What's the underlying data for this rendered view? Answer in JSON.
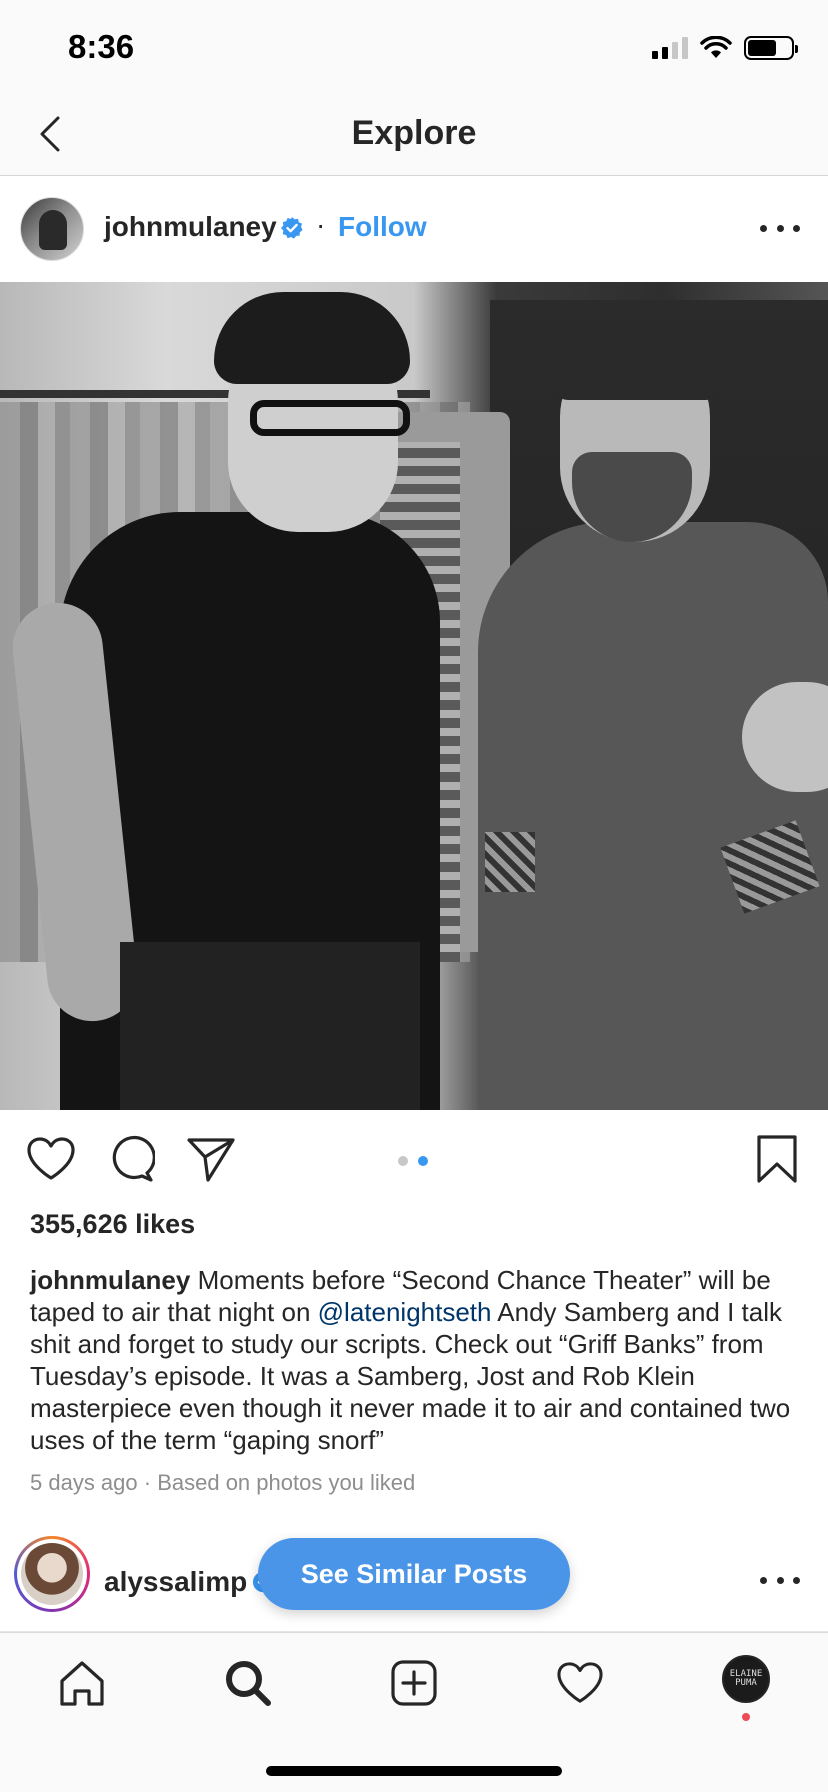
{
  "status_bar": {
    "time": "8:36"
  },
  "header": {
    "title": "Explore"
  },
  "post": {
    "username": "johnmulaney",
    "separator": "·",
    "follow_label": "Follow",
    "likes": "355,626 likes",
    "caption_user": "johnmulaney",
    "caption_part1": " Moments before “Second Chance Theater” will be taped to air that night on ",
    "caption_mention": "@latenightseth",
    "caption_part2": " Andy Samberg and I talk shit and forget to study our scripts. Check out “Griff Banks” from Tuesday’s episode. It was a Samberg, Jost and Rob Klein masterpiece even though it never made it to air and contained two uses of the term “gaping snorf”",
    "time_ago": "5 days ago",
    "meta_separator": " · ",
    "reason": "Based on photos you liked",
    "carousel": {
      "count": 2,
      "active_index": 1
    }
  },
  "next_post": {
    "username": "alyssalimp"
  },
  "similar_button": {
    "label": "See Similar Posts"
  },
  "tab_bar": {
    "items": [
      "home-icon",
      "search-icon",
      "add-post-icon",
      "activity-heart-icon",
      "profile-avatar"
    ],
    "profile_avatar_text": "ELAINE\nPUMA"
  },
  "colors": {
    "accent": "#3897f0",
    "button": "#4a95e8",
    "text": "#262626",
    "muted": "#8e8e8e",
    "mention": "#003569"
  }
}
